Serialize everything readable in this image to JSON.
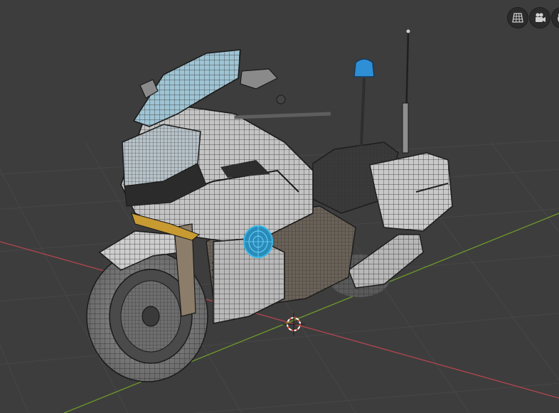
{
  "app": "3D viewport",
  "viewport": {
    "background": "#3d3d3d",
    "grid_color": "#474747",
    "x_axis_color": "#b3454f",
    "y_axis_color": "#6f9a2a"
  },
  "navigation_gizmo": {
    "buttons": [
      {
        "icon": "grid-perspective-icon"
      },
      {
        "icon": "camera-view-icon"
      },
      {
        "icon": "hand-pan-icon"
      }
    ]
  },
  "scene": {
    "object": "police-motorcycle-wireframe",
    "selected_element": "headlight-disc",
    "selection_color": "#35b7e8",
    "siren_light_color": "#2f8fd6",
    "indicator_color": "#c79a32",
    "cursor_color": "#e0543c"
  }
}
